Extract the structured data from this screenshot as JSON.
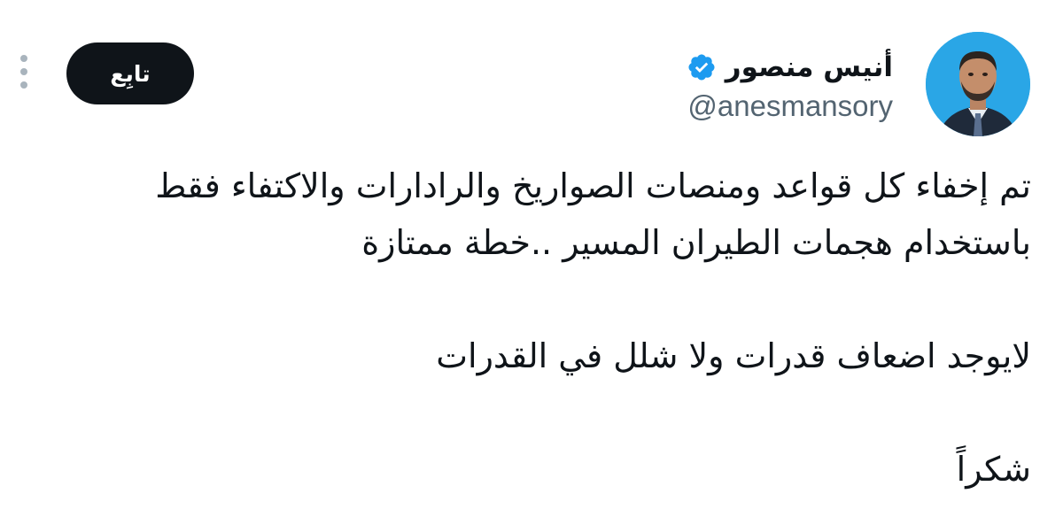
{
  "author": {
    "display_name": "أنيس منصور",
    "handle": "@anesmansory",
    "verified": true
  },
  "actions": {
    "follow_label": "تابِع"
  },
  "icons": {
    "verified": "verified-badge-icon",
    "more": "more-vertical-icon"
  },
  "colors": {
    "follow_bg": "#0f1419",
    "verified": "#1d9bf0",
    "handle": "#536471"
  },
  "tweet": {
    "lines": [
      "تم إخفاء كل قواعد ومنصات الصواريخ والرادارات والاكتفاء فقط",
      "باستخدام هجمات الطيران المسير ..خطة ممتازة",
      "لايوجد اضعاف قدرات ولا شلل في القدرات",
      "شكراً"
    ]
  }
}
